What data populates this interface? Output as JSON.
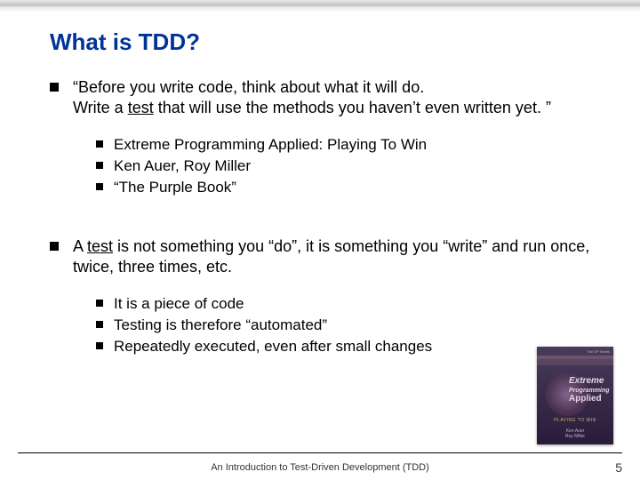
{
  "title": "What is TDD?",
  "block1": {
    "line1": "“Before you write code, think about what it will do.",
    "line2_pre": "Write a ",
    "line2_u": "test",
    "line2_post": " that will use the methods you haven’t even written yet. ”",
    "sub": [
      "Extreme Programming Applied: Playing To Win",
      "Ken Auer, Roy Miller",
      "“The Purple Book”"
    ]
  },
  "block2": {
    "line_pre": "A ",
    "line_u": "test",
    "line_post": " is not something you “do”, it is something you “write” and run once, twice, three times, etc.",
    "sub": [
      "It is a piece of code",
      "Testing is therefore “automated”",
      "Repeatedly executed, even after small changes"
    ]
  },
  "footer": "An Introduction to Test-Driven Development (TDD)",
  "page": "5",
  "book": {
    "series": "The XP Series",
    "title1": "Extreme",
    "title2": "Programming",
    "title3": "Applied",
    "sub": "PLAYING TO WIN",
    "auth": "Ken Auer\nRoy Miller"
  }
}
